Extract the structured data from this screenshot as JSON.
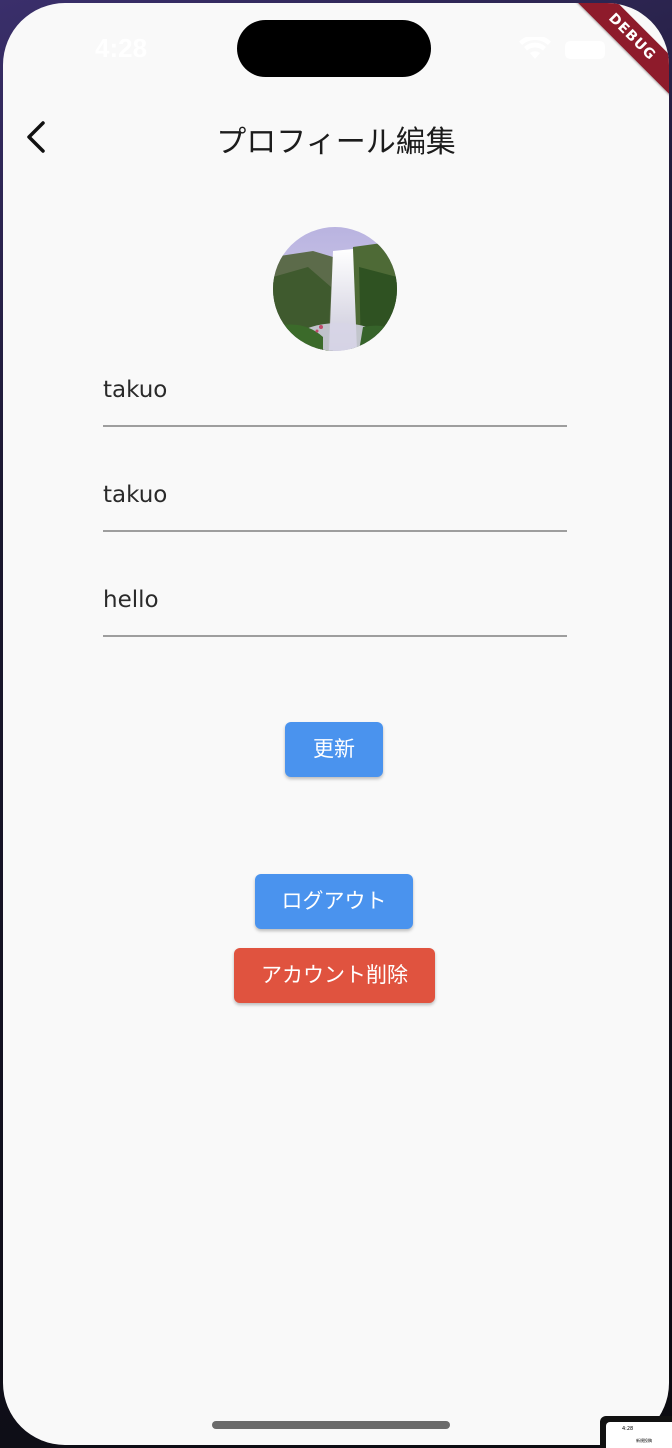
{
  "status_bar": {
    "time": "4:28"
  },
  "debug_banner": "DEBUG",
  "app_bar": {
    "title": "プロフィール編集",
    "back_icon": "chevron-left-icon"
  },
  "avatar": {
    "image": "waterfall-photo"
  },
  "fields": [
    {
      "value": "takuo"
    },
    {
      "value": "takuo"
    },
    {
      "value": "hello"
    }
  ],
  "buttons": {
    "update": "更新",
    "logout": "ログアウト",
    "delete_account": "アカウント削除"
  },
  "colors": {
    "primary_button": "#4a93ee",
    "danger_button": "#e0533f",
    "background": "#f9f9f9"
  },
  "mini_preview": {
    "time": "4:28",
    "title": "新規投稿"
  }
}
